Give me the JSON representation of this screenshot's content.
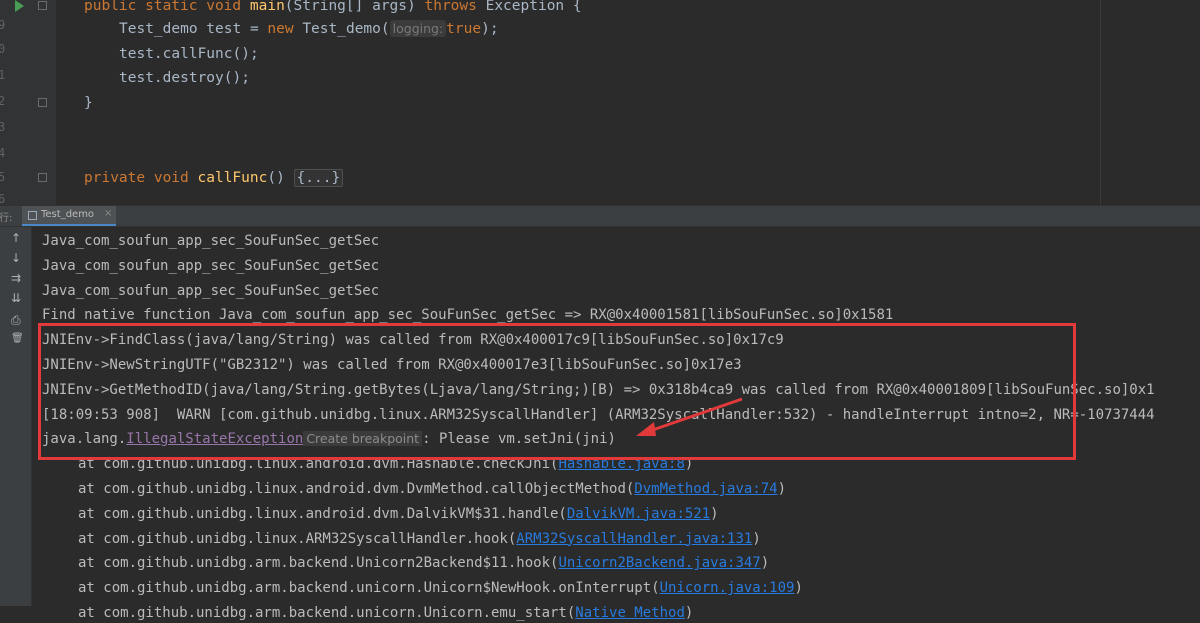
{
  "editor": {
    "gutter_numbers": [
      "9",
      "0",
      "1",
      "2",
      "3",
      "4",
      "5",
      "6"
    ],
    "lines": [
      {
        "parts": [
          {
            "t": "public static void ",
            "c": "kw"
          },
          {
            "t": "main",
            "c": "fn"
          },
          {
            "t": "(String[] args) ",
            "c": ""
          },
          {
            "t": "throws ",
            "c": "kw"
          },
          {
            "t": "Exception {",
            "c": ""
          }
        ],
        "indent": 0
      },
      {
        "parts": [
          {
            "t": "Test_demo test = ",
            "c": ""
          },
          {
            "t": "new ",
            "c": "kw"
          },
          {
            "t": "Test_demo(",
            "c": ""
          },
          {
            "t": "logging:",
            "c": "hint"
          },
          {
            "t": "true",
            "c": "kw"
          },
          {
            "t": ");",
            "c": ""
          }
        ],
        "indent": 1
      },
      {
        "parts": [
          {
            "t": "test.callFunc();",
            "c": ""
          }
        ],
        "indent": 1
      },
      {
        "parts": [
          {
            "t": "test.destroy();",
            "c": ""
          }
        ],
        "indent": 1
      },
      {
        "parts": [
          {
            "t": "}",
            "c": ""
          }
        ],
        "indent": 0
      },
      {
        "parts": [
          {
            "t": "private void ",
            "c": "kw"
          },
          {
            "t": "callFunc",
            "c": "fn"
          },
          {
            "t": "() ",
            "c": ""
          },
          {
            "t": "{...}",
            "c": "fold"
          }
        ],
        "indent": 0
      }
    ]
  },
  "run_panel": {
    "side_label": "行:",
    "tab_label": "Test_demo",
    "tab_close": "×",
    "toolbar_icons": [
      "arrow-up-icon",
      "arrow-down-icon",
      "soft-wrap-icon",
      "scroll-to-end-icon",
      "print-icon",
      "trash-icon"
    ],
    "toolbar_glyphs": [
      "↑",
      "↓",
      "⇉",
      "⇊",
      "⎙",
      "🗑"
    ]
  },
  "console": {
    "lines": [
      "Java_com_soufun_app_sec_SouFunSec_getSec",
      "Java_com_soufun_app_sec_SouFunSec_getSec",
      "Java_com_soufun_app_sec_SouFunSec_getSec",
      "Find native function Java_com_soufun_app_sec_SouFunSec_getSec => RX@0x40001581[libSouFunSec.so]0x1581",
      "JNIEnv->FindClass(java/lang/String) was called from RX@0x400017c9[libSouFunSec.so]0x17c9",
      "JNIEnv->NewStringUTF(\"GB2312\") was called from RX@0x400017e3[libSouFunSec.so]0x17e3",
      "JNIEnv->GetMethodID(java/lang/String.getBytes(Ljava/lang/String;)[B) => 0x318b4ca9 was called from RX@0x40001809[libSouFunSec.so]0x1",
      "[18:09:53 908]  WARN [com.github.unidbg.linux.ARM32SyscallHandler] (ARM32SyscallHandler:532) - handleInterrupt intno=2, NR=-10737444"
    ],
    "exception": {
      "prefix": "java.lang.",
      "name": "IllegalStateException",
      "breakpoint": "Create breakpoint",
      "message": ": Please vm.setJni(jni)"
    },
    "stack": [
      {
        "prefix": "at com.github.unidbg.linux.android.dvm.Hashable.checkJni(",
        "link": "Hashable.java:8",
        "suffix": ")"
      },
      {
        "prefix": "at com.github.unidbg.linux.android.dvm.DvmMethod.callObjectMethod(",
        "link": "DvmMethod.java:74",
        "suffix": ")"
      },
      {
        "prefix": "at com.github.unidbg.linux.android.dvm.DalvikVM$31.handle(",
        "link": "DalvikVM.java:521",
        "suffix": ")"
      },
      {
        "prefix": "at com.github.unidbg.linux.ARM32SyscallHandler.hook(",
        "link": "ARM32SyscallHandler.java:131",
        "suffix": ")"
      },
      {
        "prefix": "at com.github.unidbg.arm.backend.Unicorn2Backend$11.hook(",
        "link": "Unicorn2Backend.java:347",
        "suffix": ")"
      },
      {
        "prefix": "at com.github.unidbg.arm.backend.unicorn.Unicorn$NewHook.onInterrupt(",
        "link": "Unicorn.java:109",
        "suffix": ")"
      },
      {
        "prefix": "at com.github.unidbg.arm.backend.unicorn.Unicorn.emu_start(",
        "link": "Native Method",
        "suffix": ")"
      }
    ]
  },
  "colors": {
    "annotation": "#e23a3a",
    "link": "#287bde",
    "keyword": "#cc7832",
    "function": "#ffc66d"
  }
}
